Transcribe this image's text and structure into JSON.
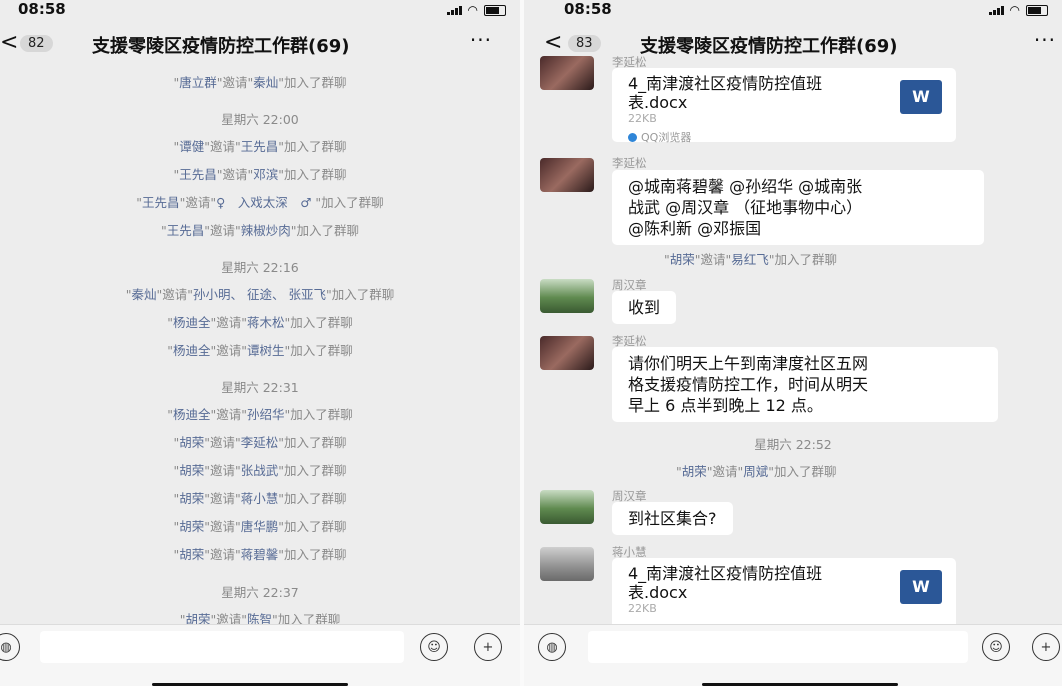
{
  "left": {
    "time": "08:58",
    "unread": "82",
    "title": "支援零陵区疫情防控工作群(69)",
    "more": "···",
    "back": "<",
    "events": [
      {
        "type": "sys",
        "a": "唐立群",
        "b": "秦灿"
      },
      {
        "type": "time",
        "text": "星期六 22:00"
      },
      {
        "type": "sys",
        "a": "谭健",
        "b": "王先昌"
      },
      {
        "type": "sys",
        "a": "王先昌",
        "b": "邓滨"
      },
      {
        "type": "sys",
        "a": "王先昌",
        "b": "♀　入戏太深　♂ "
      },
      {
        "type": "sys",
        "a": "王先昌",
        "b": "辣椒炒肉"
      },
      {
        "type": "time",
        "text": "星期六 22:16"
      },
      {
        "type": "sys",
        "a": "秦灿",
        "b": "孙小明、 征途、 张亚飞"
      },
      {
        "type": "sys",
        "a": "杨迪全",
        "b": "蒋木松"
      },
      {
        "type": "sys",
        "a": "杨迪全",
        "b": "谭树生"
      },
      {
        "type": "time",
        "text": "星期六 22:31"
      },
      {
        "type": "sys",
        "a": "杨迪全",
        "b": "孙绍华"
      },
      {
        "type": "sys",
        "a": "胡荣",
        "b": "李延松"
      },
      {
        "type": "sys",
        "a": "胡荣",
        "b": "张战武"
      },
      {
        "type": "sys",
        "a": "胡荣",
        "b": "蒋小慧"
      },
      {
        "type": "sys",
        "a": "胡荣",
        "b": "唐华鹏"
      },
      {
        "type": "sys",
        "a": "胡荣",
        "b": "蒋碧馨"
      },
      {
        "type": "time",
        "text": "星期六 22:37"
      },
      {
        "type": "sys",
        "a": "胡荣",
        "b": "陈智"
      }
    ]
  },
  "right": {
    "time": "08:58",
    "unread": "83",
    "title": "支援零陵区疫情防控工作群(69)",
    "more": "···",
    "back": "<",
    "file1": {
      "sender": "李延松",
      "name": "4_南津渡社区疫情防控值班表.docx",
      "size": "22KB",
      "source": "QQ浏览器",
      "icon": "W"
    },
    "msg1": {
      "sender": "李延松",
      "lines": [
        "@城南蒋碧馨 @孙绍华 @城南张",
        "战武 @周汉章 （征地事物中心）",
        "@陈利新 @邓振国"
      ]
    },
    "sys1": {
      "a": "胡荣",
      "b": "易红飞"
    },
    "msg2": {
      "sender": "周汉章",
      "text": "收到"
    },
    "msg3": {
      "sender": "李延松",
      "lines": [
        "请你们明天上午到南津度社区五网",
        "格支援疫情防控工作，时间从明天",
        "早上 6 点半到晚上 12 点。"
      ]
    },
    "time1": "星期六 22:52",
    "sys2": {
      "a": "胡荣",
      "b": "周斌"
    },
    "msg4": {
      "sender": "周汉章",
      "text": "到社区集合?"
    },
    "file2": {
      "sender": "蒋小慧",
      "name": "4_南津渡社区疫情防控值班表.docx",
      "size": "22KB",
      "icon": "W"
    }
  },
  "labels": {
    "invite": "邀请",
    "joined": "加入了群聊",
    "q": "\""
  },
  "icons": {
    "voice": "voice-icon",
    "emoji": "emoji-icon",
    "plus": "plus-icon"
  }
}
